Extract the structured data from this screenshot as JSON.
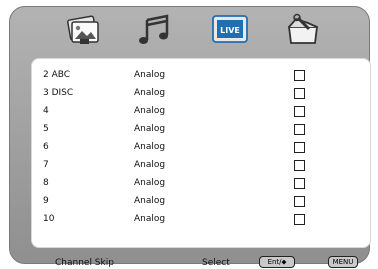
{
  "tabs": [
    {
      "icon": "picture-icon",
      "active": false
    },
    {
      "icon": "music-icon",
      "active": false
    },
    {
      "icon": "live-tv-icon",
      "label": "LIVE",
      "active": true
    },
    {
      "icon": "settings-toolbox-icon",
      "active": false
    }
  ],
  "channels": [
    {
      "number": "2 ABC",
      "type": "Analog",
      "skipped": false
    },
    {
      "number": "3 DISC",
      "type": "Analog",
      "skipped": false
    },
    {
      "number": "4",
      "type": "Analog",
      "skipped": false
    },
    {
      "number": "5",
      "type": "Analog",
      "skipped": false
    },
    {
      "number": "6",
      "type": "Analog",
      "skipped": false
    },
    {
      "number": "7",
      "type": "Analog",
      "skipped": false
    },
    {
      "number": "8",
      "type": "Analog",
      "skipped": false
    },
    {
      "number": "9",
      "type": "Analog",
      "skipped": false
    },
    {
      "number": "10",
      "type": "Analog",
      "skipped": false
    }
  ],
  "footer": {
    "title": "Channel Skip",
    "select_label": "Select",
    "nav_key": "Ent/⬥",
    "menu_key": "MENU"
  },
  "colors": {
    "frame": "#a6a6a6",
    "active_tab": "#1f6fb3"
  }
}
